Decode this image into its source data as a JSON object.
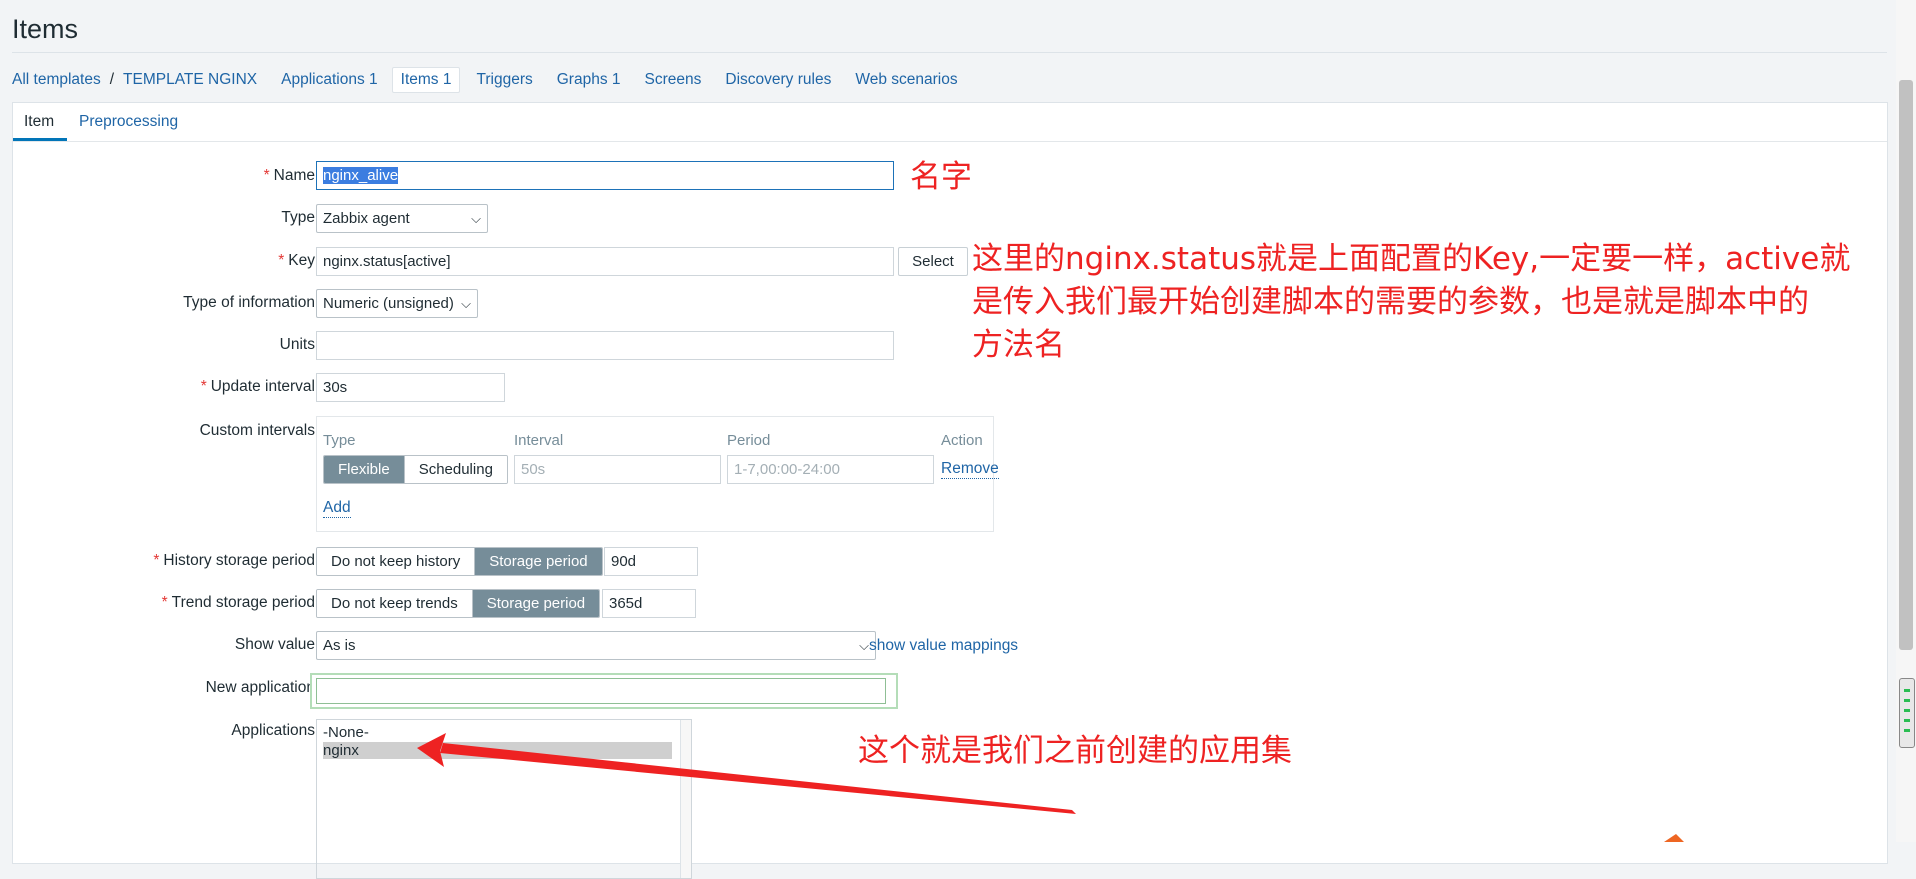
{
  "page": {
    "title": "Items"
  },
  "nav": {
    "all_templates": "All templates",
    "separator": "/",
    "template": "TEMPLATE NGINX",
    "applications": "Applications 1",
    "items": "Items 1",
    "triggers": "Triggers",
    "graphs": "Graphs 1",
    "screens": "Screens",
    "discovery": "Discovery rules",
    "web": "Web scenarios"
  },
  "tabs": {
    "item": "Item",
    "preprocessing": "Preprocessing"
  },
  "form": {
    "required_mark": "*",
    "name": {
      "label": "Name",
      "value": "nginx_alive"
    },
    "type": {
      "label": "Type",
      "value": "Zabbix agent"
    },
    "key": {
      "label": "Key",
      "value": "nginx.status[active]",
      "select": "Select"
    },
    "type_info": {
      "label": "Type of information",
      "value": "Numeric (unsigned)"
    },
    "units": {
      "label": "Units",
      "value": ""
    },
    "update": {
      "label": "Update interval",
      "value": "30s"
    },
    "custom": {
      "label": "Custom intervals",
      "col_type": "Type",
      "col_interval": "Interval",
      "col_period": "Period",
      "col_action": "Action",
      "flexible": "Flexible",
      "scheduling": "Scheduling",
      "interval_placeholder": "50s",
      "period_placeholder": "1-7,00:00-24:00",
      "remove": "Remove",
      "add": "Add"
    },
    "history": {
      "label": "History storage period",
      "opt_off": "Do not keep history",
      "opt_on": "Storage period",
      "value": "90d"
    },
    "trend": {
      "label": "Trend storage period",
      "opt_off": "Do not keep trends",
      "opt_on": "Storage period",
      "value": "365d"
    },
    "show_value": {
      "label": "Show value",
      "value": "As is",
      "mappings": "show value mappings"
    },
    "new_app": {
      "label": "New application",
      "value": ""
    },
    "applications": {
      "label": "Applications",
      "options": [
        "-None-",
        "nginx"
      ]
    }
  },
  "annotations": {
    "name_note": "名字",
    "key_note_1": "这里的nginx.status就是上面配置的Key,一定要一样，active就",
    "key_note_2": "是传入我们最开始创建脚本的需要的参数，也是就是脚本中的",
    "key_note_3": "方法名",
    "app_note": "这个就是我们之前创建的应用集"
  },
  "icons": {
    "dropdown": "chevron-down-icon"
  },
  "colors": {
    "accent": "#0275b8",
    "link": "#1f65a6",
    "segment_on": "#768d99",
    "annotation": "#ee2222",
    "required": "#e33734"
  }
}
